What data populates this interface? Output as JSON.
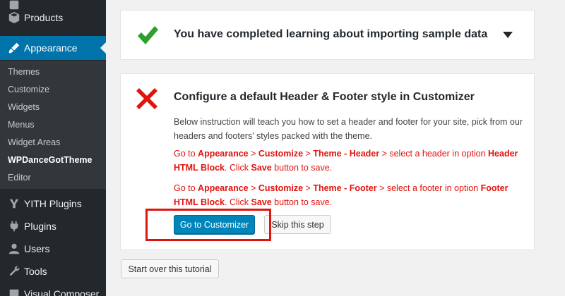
{
  "sidebar": {
    "items": [
      {
        "label": "Products",
        "icon": "products-icon"
      },
      {
        "label": "Appearance",
        "icon": "appearance-icon",
        "active": true
      },
      {
        "label": "YITH Plugins",
        "icon": "yith-icon"
      },
      {
        "label": "Plugins",
        "icon": "plugins-icon"
      },
      {
        "label": "Users",
        "icon": "users-icon"
      },
      {
        "label": "Tools",
        "icon": "tools-icon"
      },
      {
        "label": "Visual Composer",
        "icon": "visual-composer-icon"
      }
    ],
    "submenu": [
      "Themes",
      "Customize",
      "Widgets",
      "Menus",
      "Widget Areas",
      "WPDanceGotTheme",
      "Editor"
    ],
    "current_submenu": "WPDanceGotTheme",
    "colors": {
      "background": "#23282d",
      "active": "#0073aa"
    }
  },
  "steps": {
    "done": {
      "title": "You have completed learning about importing sample data",
      "status_icon": "check-icon",
      "toggle_icon": "caret-down-icon"
    },
    "configure": {
      "title": "Configure a default Header & Footer style in Customizer",
      "status_icon": "cross-icon",
      "description": "Below instruction will teach you how to set a header and footer for your site, pick from our headers and footers' styles packed with the theme.",
      "instruction_header": {
        "t1": "Go to ",
        "b1": "Appearance",
        "t2": " > ",
        "b2": "Customize",
        "t3": " > ",
        "b3": "Theme - Header",
        "t4": " > select a header in option ",
        "b4": "Header HTML Block",
        "t5": ". Click ",
        "b5": "Save",
        "t6": " button to save."
      },
      "instruction_footer": {
        "t1": "Go to ",
        "b1": "Appearance",
        "t2": " > ",
        "b2": "Customize",
        "t3": " > ",
        "b3": "Theme - Footer",
        "t4": " > select a footer in option ",
        "b4": "Footer HTML Block",
        "t5": ". Click ",
        "b5": "Save",
        "t6": " button to save."
      },
      "primary_button": "Go to Customizer",
      "skip_button": "Skip this step"
    }
  },
  "restart_button": "Start over this tutorial",
  "colors": {
    "accent": "#0085ba",
    "success": "#2e9e2e",
    "error": "#e0140f"
  }
}
